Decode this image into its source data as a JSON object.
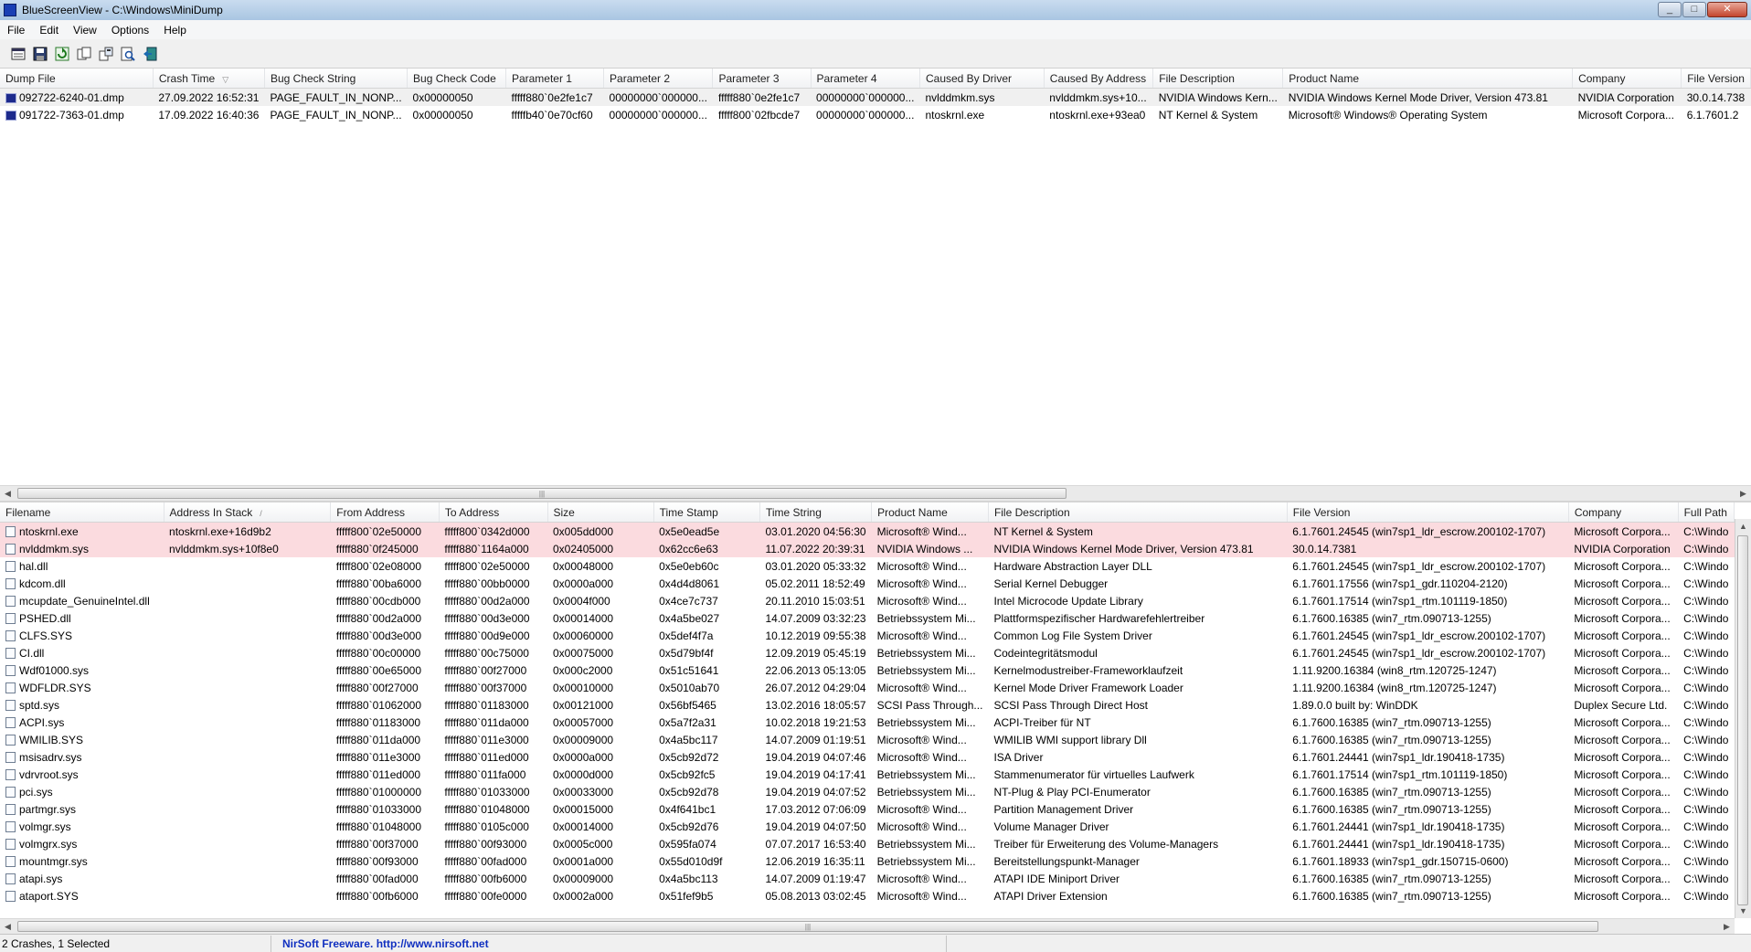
{
  "window": {
    "title": "BlueScreenView  -  C:\\Windows\\MiniDump",
    "minimize": "_",
    "maximize": "□",
    "close": "✕"
  },
  "menu": [
    "File",
    "Edit",
    "View",
    "Options",
    "Help"
  ],
  "toolbar": [
    "properties-icon",
    "save-icon",
    "refresh-icon",
    "copy-icon",
    "advanced-options-icon",
    "find-icon",
    "exit-icon"
  ],
  "dumps": {
    "columns": [
      "Dump File",
      "Crash Time",
      "Bug Check String",
      "Bug Check Code",
      "Parameter 1",
      "Parameter 2",
      "Parameter 3",
      "Parameter 4",
      "Caused By Driver",
      "Caused By Address",
      "File Description",
      "Product Name",
      "Company",
      "File Version"
    ],
    "sort_indicator": "▽",
    "rows": [
      [
        "092722-6240-01.dmp",
        "27.09.2022 16:52:31",
        "PAGE_FAULT_IN_NONP...",
        "0x00000050",
        "fffff880`0e2fe1c7",
        "00000000`000000...",
        "fffff880`0e2fe1c7",
        "00000000`000000...",
        "nvlddmkm.sys",
        "nvlddmkm.sys+10...",
        "NVIDIA Windows Kern...",
        "NVIDIA Windows Kernel Mode Driver, Version 473.81",
        "NVIDIA Corporation",
        "30.0.14.738"
      ],
      [
        "091722-7363-01.dmp",
        "17.09.2022 16:40:36",
        "PAGE_FAULT_IN_NONP...",
        "0x00000050",
        "fffffb40`0e70cf60",
        "00000000`000000...",
        "fffff800`02fbcde7",
        "00000000`000000...",
        "ntoskrnl.exe",
        "ntoskrnl.exe+93ea0",
        "NT Kernel & System",
        "Microsoft® Windows® Operating System",
        "Microsoft Corpora...",
        "6.1.7601.2"
      ]
    ]
  },
  "modules": {
    "columns": [
      "Filename",
      "Address In Stack",
      "From Address",
      "To Address",
      "Size",
      "Time Stamp",
      "Time String",
      "Product Name",
      "File Description",
      "File Version",
      "Company",
      "Full Path"
    ],
    "sort_indicator": "/",
    "rows": [
      [
        "ntoskrnl.exe",
        "ntoskrnl.exe+16d9b2",
        "fffff800`02e50000",
        "fffff800`0342d000",
        "0x005dd000",
        "0x5e0ead5e",
        "03.01.2020 04:56:30",
        "Microsoft® Wind...",
        "NT Kernel & System",
        "6.1.7601.24545 (win7sp1_ldr_escrow.200102-1707)",
        "Microsoft Corpora...",
        "C:\\Windo"
      ],
      [
        "nvlddmkm.sys",
        "nvlddmkm.sys+10f8e0",
        "fffff880`0f245000",
        "fffff880`1164a000",
        "0x02405000",
        "0x62cc6e63",
        "11.07.2022 20:39:31",
        "NVIDIA Windows ...",
        "NVIDIA Windows Kernel Mode Driver, Version 473.81",
        "30.0.14.7381",
        "NVIDIA Corporation",
        "C:\\Windo"
      ],
      [
        "hal.dll",
        "",
        "fffff800`02e08000",
        "fffff800`02e50000",
        "0x00048000",
        "0x5e0eb60c",
        "03.01.2020 05:33:32",
        "Microsoft® Wind...",
        "Hardware Abstraction Layer DLL",
        "6.1.7601.24545 (win7sp1_ldr_escrow.200102-1707)",
        "Microsoft Corpora...",
        "C:\\Windo"
      ],
      [
        "kdcom.dll",
        "",
        "fffff880`00ba6000",
        "fffff880`00bb0000",
        "0x0000a000",
        "0x4d4d8061",
        "05.02.2011 18:52:49",
        "Microsoft® Wind...",
        "Serial Kernel Debugger",
        "6.1.7601.17556 (win7sp1_gdr.110204-2120)",
        "Microsoft Corpora...",
        "C:\\Windo"
      ],
      [
        "mcupdate_GenuineIntel.dll",
        "",
        "fffff880`00cdb000",
        "fffff880`00d2a000",
        "0x0004f000",
        "0x4ce7c737",
        "20.11.2010 15:03:51",
        "Microsoft® Wind...",
        "Intel Microcode Update Library",
        "6.1.7601.17514 (win7sp1_rtm.101119-1850)",
        "Microsoft Corpora...",
        "C:\\Windo"
      ],
      [
        "PSHED.dll",
        "",
        "fffff880`00d2a000",
        "fffff880`00d3e000",
        "0x00014000",
        "0x4a5be027",
        "14.07.2009 03:32:23",
        "Betriebssystem Mi...",
        "Plattformspezifischer Hardwarefehlertreiber",
        "6.1.7600.16385 (win7_rtm.090713-1255)",
        "Microsoft Corpora...",
        "C:\\Windo"
      ],
      [
        "CLFS.SYS",
        "",
        "fffff880`00d3e000",
        "fffff880`00d9e000",
        "0x00060000",
        "0x5def4f7a",
        "10.12.2019 09:55:38",
        "Microsoft® Wind...",
        "Common Log File System Driver",
        "6.1.7601.24545 (win7sp1_ldr_escrow.200102-1707)",
        "Microsoft Corpora...",
        "C:\\Windo"
      ],
      [
        "CI.dll",
        "",
        "fffff880`00c00000",
        "fffff880`00c75000",
        "0x00075000",
        "0x5d79bf4f",
        "12.09.2019 05:45:19",
        "Betriebssystem Mi...",
        "Codeintegritätsmodul",
        "6.1.7601.24545 (win7sp1_ldr_escrow.200102-1707)",
        "Microsoft Corpora...",
        "C:\\Windo"
      ],
      [
        "Wdf01000.sys",
        "",
        "fffff880`00e65000",
        "fffff880`00f27000",
        "0x000c2000",
        "0x51c51641",
        "22.06.2013 05:13:05",
        "Betriebssystem Mi...",
        "Kernelmodustreiber-Frameworklaufzeit",
        "1.11.9200.16384 (win8_rtm.120725-1247)",
        "Microsoft Corpora...",
        "C:\\Windo"
      ],
      [
        "WDFLDR.SYS",
        "",
        "fffff880`00f27000",
        "fffff880`00f37000",
        "0x00010000",
        "0x5010ab70",
        "26.07.2012 04:29:04",
        "Microsoft® Wind...",
        "Kernel Mode Driver Framework Loader",
        "1.11.9200.16384 (win8_rtm.120725-1247)",
        "Microsoft Corpora...",
        "C:\\Windo"
      ],
      [
        "sptd.sys",
        "",
        "fffff880`01062000",
        "fffff880`01183000",
        "0x00121000",
        "0x56bf5465",
        "13.02.2016 18:05:57",
        "SCSI Pass Through...",
        "SCSI Pass Through Direct Host",
        "1.89.0.0 built by: WinDDK",
        "Duplex Secure Ltd.",
        "C:\\Windo"
      ],
      [
        "ACPI.sys",
        "",
        "fffff880`01183000",
        "fffff880`011da000",
        "0x00057000",
        "0x5a7f2a31",
        "10.02.2018 19:21:53",
        "Betriebssystem Mi...",
        "ACPI-Treiber für NT",
        "6.1.7600.16385 (win7_rtm.090713-1255)",
        "Microsoft Corpora...",
        "C:\\Windo"
      ],
      [
        "WMILIB.SYS",
        "",
        "fffff880`011da000",
        "fffff880`011e3000",
        "0x00009000",
        "0x4a5bc117",
        "14.07.2009 01:19:51",
        "Microsoft® Wind...",
        "WMILIB WMI support library Dll",
        "6.1.7600.16385 (win7_rtm.090713-1255)",
        "Microsoft Corpora...",
        "C:\\Windo"
      ],
      [
        "msisadrv.sys",
        "",
        "fffff880`011e3000",
        "fffff880`011ed000",
        "0x0000a000",
        "0x5cb92d72",
        "19.04.2019 04:07:46",
        "Microsoft® Wind...",
        "ISA Driver",
        "6.1.7601.24441 (win7sp1_ldr.190418-1735)",
        "Microsoft Corpora...",
        "C:\\Windo"
      ],
      [
        "vdrvroot.sys",
        "",
        "fffff880`011ed000",
        "fffff880`011fa000",
        "0x0000d000",
        "0x5cb92fc5",
        "19.04.2019 04:17:41",
        "Betriebssystem Mi...",
        "Stammenumerator für virtuelles Laufwerk",
        "6.1.7601.17514 (win7sp1_rtm.101119-1850)",
        "Microsoft Corpora...",
        "C:\\Windo"
      ],
      [
        "pci.sys",
        "",
        "fffff880`01000000",
        "fffff880`01033000",
        "0x00033000",
        "0x5cb92d78",
        "19.04.2019 04:07:52",
        "Betriebssystem Mi...",
        "NT-Plug & Play PCI-Enumerator",
        "6.1.7600.16385 (win7_rtm.090713-1255)",
        "Microsoft Corpora...",
        "C:\\Windo"
      ],
      [
        "partmgr.sys",
        "",
        "fffff880`01033000",
        "fffff880`01048000",
        "0x00015000",
        "0x4f641bc1",
        "17.03.2012 07:06:09",
        "Microsoft® Wind...",
        "Partition Management Driver",
        "6.1.7600.16385 (win7_rtm.090713-1255)",
        "Microsoft Corpora...",
        "C:\\Windo"
      ],
      [
        "volmgr.sys",
        "",
        "fffff880`01048000",
        "fffff880`0105c000",
        "0x00014000",
        "0x5cb92d76",
        "19.04.2019 04:07:50",
        "Microsoft® Wind...",
        "Volume Manager Driver",
        "6.1.7601.24441 (win7sp1_ldr.190418-1735)",
        "Microsoft Corpora...",
        "C:\\Windo"
      ],
      [
        "volmgrx.sys",
        "",
        "fffff880`00f37000",
        "fffff880`00f93000",
        "0x0005c000",
        "0x595fa074",
        "07.07.2017 16:53:40",
        "Betriebssystem Mi...",
        "Treiber für Erweiterung des Volume-Managers",
        "6.1.7601.24441 (win7sp1_ldr.190418-1735)",
        "Microsoft Corpora...",
        "C:\\Windo"
      ],
      [
        "mountmgr.sys",
        "",
        "fffff880`00f93000",
        "fffff880`00fad000",
        "0x0001a000",
        "0x55d010d9f",
        "12.06.2019 16:35:11",
        "Betriebssystem Mi...",
        "Bereitstellungspunkt-Manager",
        "6.1.7601.18933 (win7sp1_gdr.150715-0600)",
        "Microsoft Corpora...",
        "C:\\Windo"
      ],
      [
        "atapi.sys",
        "",
        "fffff880`00fad000",
        "fffff880`00fb6000",
        "0x00009000",
        "0x4a5bc113",
        "14.07.2009 01:19:47",
        "Microsoft® Wind...",
        "ATAPI IDE Miniport Driver",
        "6.1.7600.16385 (win7_rtm.090713-1255)",
        "Microsoft Corpora...",
        "C:\\Windo"
      ],
      [
        "ataport.SYS",
        "",
        "fffff880`00fb6000",
        "fffff880`00fe0000",
        "0x0002a000",
        "0x51fef9b5",
        "05.08.2013 03:02:45",
        "Microsoft® Wind...",
        "ATAPI Driver Extension",
        "6.1.7600.16385 (win7_rtm.090713-1255)",
        "Microsoft Corpora...",
        "C:\\Windo"
      ]
    ]
  },
  "scrollbar": {
    "left": "◀",
    "right": "▶",
    "up": "▲",
    "down": "▼",
    "grip": "|||"
  },
  "status": {
    "count": "2 Crashes, 1 Selected",
    "link": "NirSoft Freeware.  http://www.nirsoft.net"
  }
}
